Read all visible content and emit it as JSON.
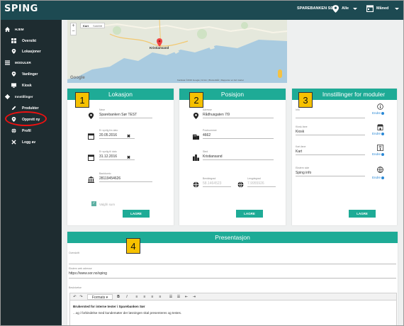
{
  "app": {
    "logo": "SPING"
  },
  "topbar": {
    "org": "SPAREBANKEN SØR",
    "location_filter": "Alle",
    "period_filter": "Måned",
    "icons": [
      "map-pin-icon",
      "calendar-icon"
    ]
  },
  "sidebar": {
    "sections": [
      {
        "label": "HJEM",
        "icon": "home-icon"
      },
      {
        "label": "Oversikt",
        "icon": "dashboard-icon"
      },
      {
        "label": "Lokasjoner",
        "icon": "map-pin-icon"
      },
      {
        "label": "MODULER",
        "icon": "modules-icon"
      },
      {
        "label": "Vanlinger",
        "icon": "map-pin-icon"
      },
      {
        "label": "Kiosk",
        "icon": "monitor-icon"
      },
      {
        "label": "Innstillinger",
        "icon": "gear-icon"
      },
      {
        "label": "Produkter",
        "icon": "pencil-icon"
      },
      {
        "label": "Opprett ny",
        "icon": "map-pin-icon"
      },
      {
        "label": "Profil",
        "icon": "globe-icon"
      },
      {
        "label": "Logg av",
        "icon": "close-icon"
      }
    ]
  },
  "map": {
    "zoom_in": "+",
    "zoom_out": "−",
    "type_map": "Kart",
    "type_satellite": "Satellitt",
    "city": "Kristiansand",
    "google": "Google",
    "attribution": "Kartdata ©2016 Google  |  10 km  |  Bruksvilkår  |  Rapporter en feil i kartet"
  },
  "lokasjon": {
    "title": "Lokasjon",
    "step": "1",
    "name_label": "Navn",
    "name_value": "Sparebanken Sør TEST",
    "from_label": "Er synlig fra dato",
    "from_value": "20.05.2016",
    "to_label": "Er synlig til dato",
    "to_value": "31.12.2016",
    "account_label": "Bankkonto",
    "account_value": "28119454626",
    "check_label": "Valgfri sum",
    "save": "LAGRE"
  },
  "posisjon": {
    "title": "Posisjon",
    "step": "2",
    "address_label": "Adresse",
    "address_value": "Rådhusgaten 7/9",
    "zip_label": "Postnummer",
    "zip_value": "4662",
    "city_label": "Sted",
    "city_value": "Kristiansand",
    "lat_label": "Breddegrad",
    "lat_value": "58.1464523",
    "lng_label": "Lengdegrad",
    "lng_value": "7.9955926",
    "save": "LAGRE"
  },
  "moduler": {
    "title": "Innstillinger for moduler",
    "step": "3",
    "info_label": "Info",
    "kiosk_label": "Kiosk-fane",
    "kiosk_value": "Kiosk",
    "map_label": "Kart-fane",
    "map_value": "Kart",
    "ext_label": "Ekstern side",
    "ext_value": "Sping info",
    "edit": "Endre",
    "save": "LAGRE"
  },
  "presentasjon": {
    "title": "Presentasjon",
    "step": "4",
    "heading_label": "Overskrift",
    "web_label": "Ekstern web adresse",
    "web_value": "https://www.sor.no/sping",
    "desc_label": "Beskrivelse",
    "format_label": "Formats",
    "body_bold": "Brukersted for interne tester i Sparebanken Sør",
    "body_text": "...og i forbindelse med kundemøter der løsningen skal presenteres og testes."
  }
}
